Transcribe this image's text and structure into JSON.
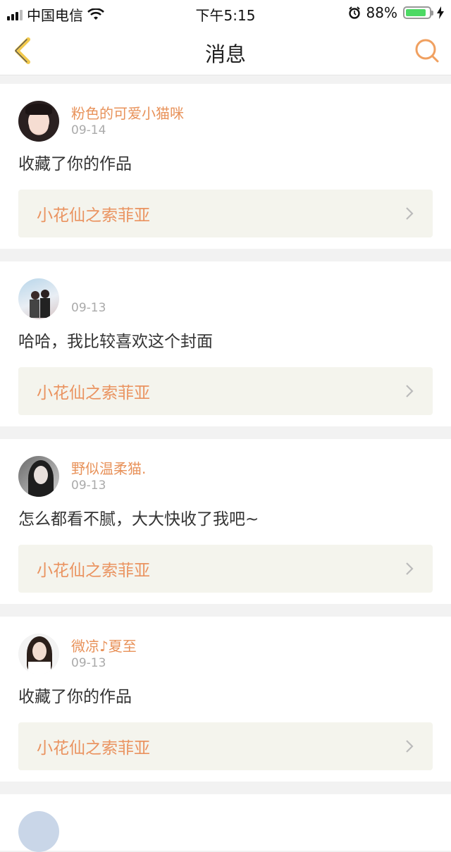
{
  "status": {
    "carrier": "中国电信",
    "time": "下午5:15",
    "battery": "88%",
    "battery_level": 0.88,
    "colors": {
      "battery_fill": "#4cd964"
    }
  },
  "nav": {
    "title": "消息",
    "back_icon": "chevron-left-icon",
    "search_icon": "search-icon",
    "colors": {
      "back": "#f2c94c",
      "search": "#f0a060"
    }
  },
  "messages": [
    {
      "username": "粉色的可爱小猫咪",
      "date": "09-14",
      "text": "收藏了你的作品",
      "work_title": "小花仙之索菲亚"
    },
    {
      "username": "",
      "date": "09-13",
      "text": "哈哈，我比较喜欢这个封面",
      "work_title": "小花仙之索菲亚"
    },
    {
      "username": "野似温柔猫.",
      "date": "09-13",
      "text": "怎么都看不腻，大大快收了我吧~",
      "work_title": "小花仙之索菲亚"
    },
    {
      "username": "微凉♪夏至",
      "date": "09-13",
      "text": "收藏了你的作品",
      "work_title": "小花仙之索菲亚"
    }
  ],
  "colors": {
    "accent": "#e8925a",
    "work_bg": "#f4f4ed",
    "page_bg": "#f2f2f2"
  }
}
